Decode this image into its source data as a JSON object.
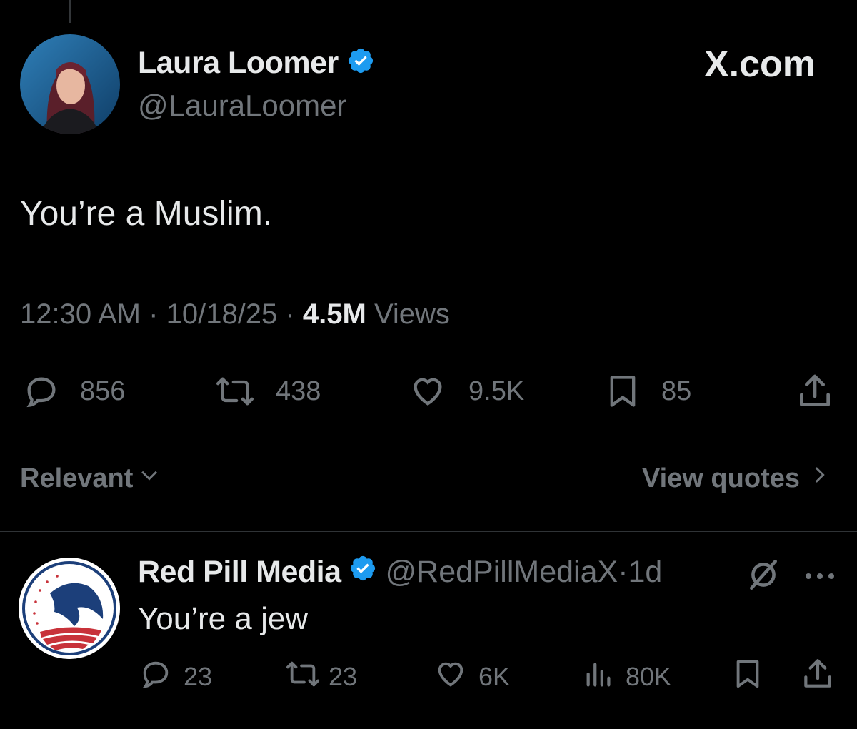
{
  "tweet": {
    "author_name": "Laura Loomer",
    "author_handle": "@LauraLoomer",
    "brand": "X.com",
    "text": "You’re a Muslim.",
    "time": "12:30 AM",
    "date": "10/18/25",
    "separator": "·",
    "views_count": "4.5M",
    "views_label": "Views",
    "stats": {
      "replies": "856",
      "reposts": "438",
      "likes": "9.5K",
      "bookmarks": "85"
    }
  },
  "sort": {
    "relevant_label": "Relevant",
    "view_quotes_label": "View quotes"
  },
  "reply": {
    "author_name": "Red Pill Media",
    "author_handle": "@RedPillMediaX",
    "separator": "·",
    "time_ago": "1d",
    "text": "You’re a jew",
    "stats": {
      "replies": "23",
      "reposts": "23",
      "likes": "6K",
      "views": "80K"
    }
  },
  "colors": {
    "background": "#000000",
    "text_primary": "#e7e9ea",
    "text_secondary": "#71767b",
    "verified_blue": "#1d9bf0",
    "divider": "#2f3336"
  }
}
